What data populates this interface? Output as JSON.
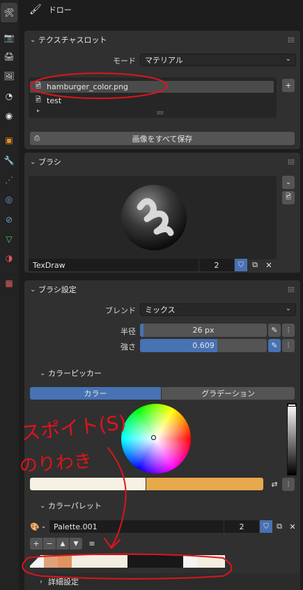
{
  "header": {
    "title": "ドロー"
  },
  "texture_slot": {
    "title": "テクスチャスロット",
    "mode_label": "モード",
    "mode_value": "マテリアル",
    "items": [
      "hamburger_color.png",
      "test"
    ],
    "save_all": "画像をすべて保存"
  },
  "brush": {
    "title": "ブラシ",
    "name": "TexDraw",
    "users": "2"
  },
  "brush_settings": {
    "title": "ブラシ設定",
    "blend_label": "ブレンド",
    "blend_value": "ミックス",
    "radius_label": "半径",
    "radius_value": "26 px",
    "strength_label": "強さ",
    "strength_value": "0.609",
    "strength_fraction": 0.609
  },
  "color_picker": {
    "title": "カラーピッカー",
    "tab_color": "カラー",
    "tab_gradient": "グラデーション",
    "primary_color": "#f6f1e2",
    "secondary_color": "#e8a94c"
  },
  "palette": {
    "title": "カラーパレット",
    "name": "Palette.001",
    "users": "2",
    "swatches": [
      "#f4f4f4",
      "#e0a27b",
      "#e0945f",
      "#f4eee2",
      "#f4eee2",
      "#f4eee2",
      "#f4eee2",
      "#181818",
      "#181818",
      "#181818",
      "#181818",
      "#f4f4f4",
      "#f4eee2",
      "#f4eee2"
    ]
  },
  "details": {
    "title": "詳細設定"
  },
  "annotations": {
    "line1": "スポイト(S)",
    "line2": "のりわき"
  },
  "colors": {
    "accent": "#4772b3",
    "panel": "#303030",
    "bg": "#1d1d1d",
    "annotation": "#e0141b"
  }
}
